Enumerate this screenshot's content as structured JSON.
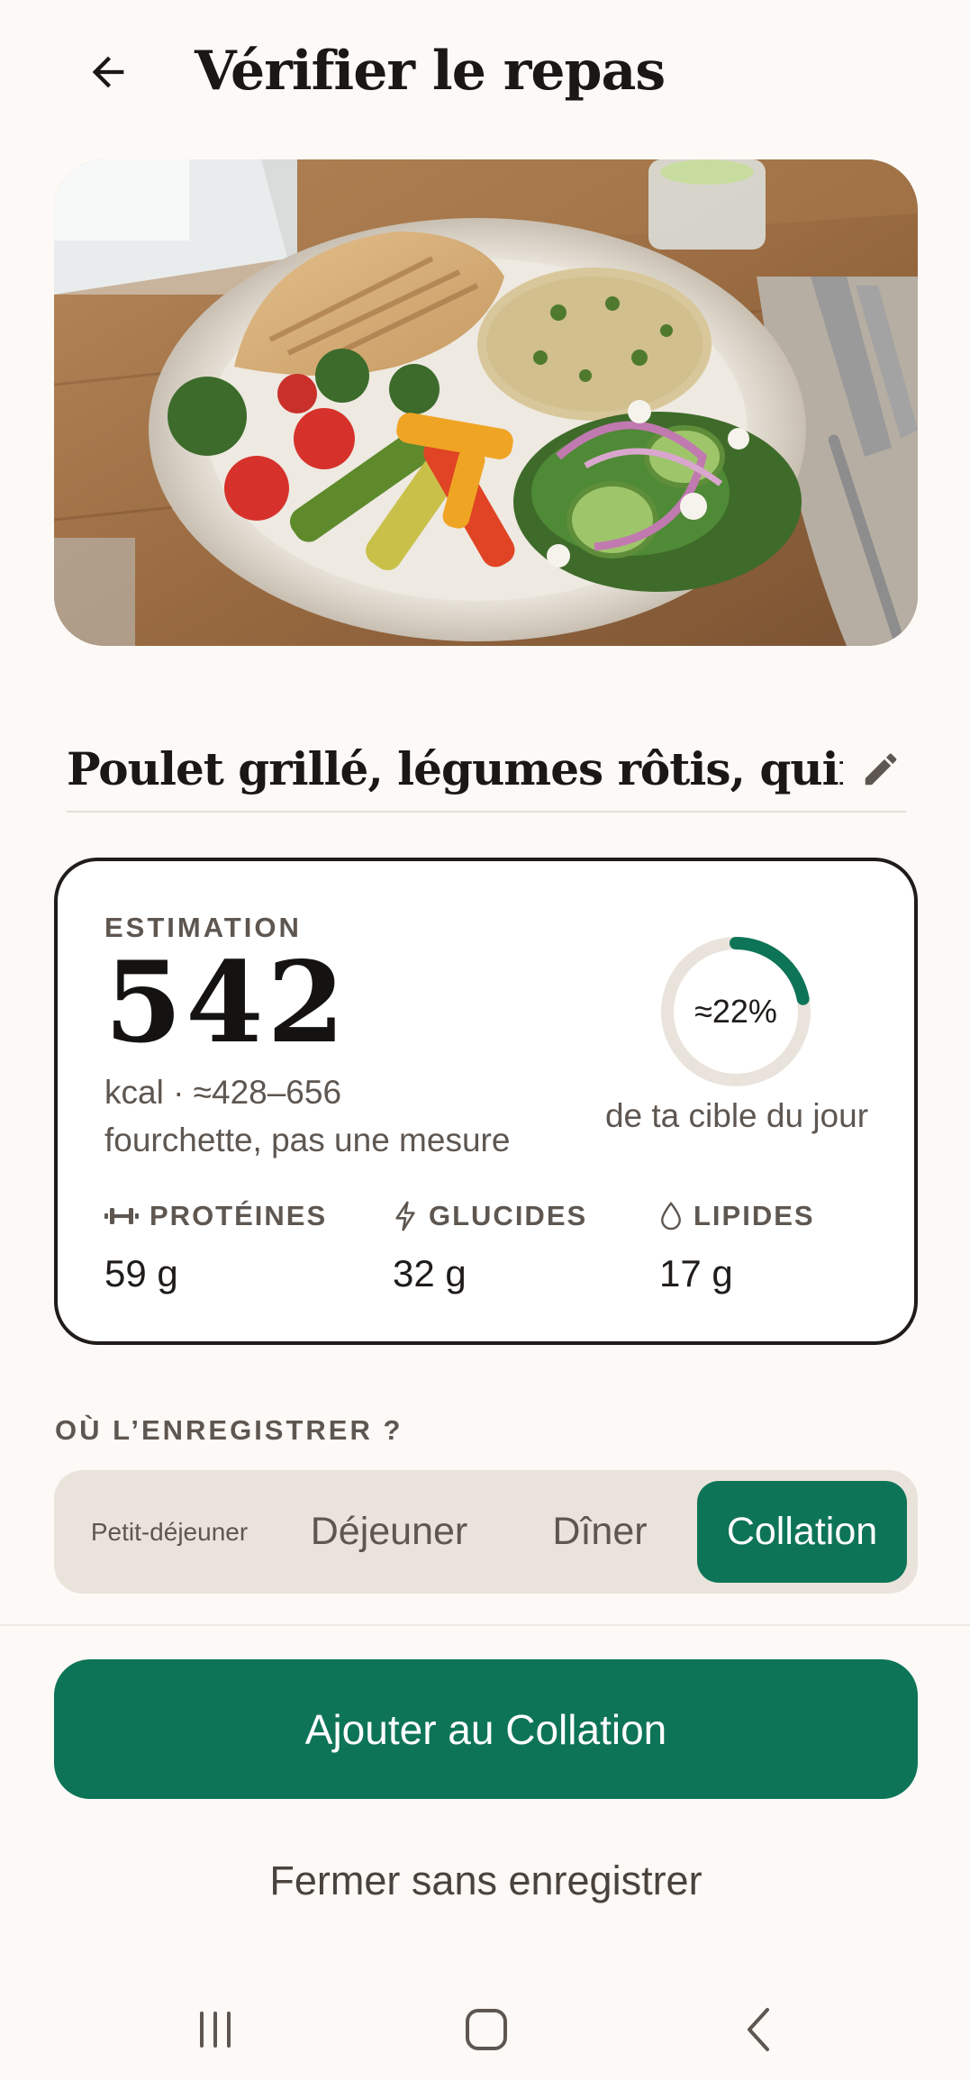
{
  "header": {
    "title": "Vérifier le repas",
    "back_icon": "arrow-left-icon"
  },
  "photo": {
    "alt": "grilled-chicken-meal-photo"
  },
  "meal": {
    "name": "Poulet grillé, légumes rôtis, quinoa",
    "edit_icon": "pencil-icon"
  },
  "estimate": {
    "label": "ESTIMATION",
    "kcal": "542",
    "range": "kcal · ≈428–656",
    "note": "fourchette, pas une mesure",
    "target_pct_label": "≈22%",
    "target_fraction": 0.22,
    "target_caption": "de ta cible du jour"
  },
  "macros": [
    {
      "icon": "dumbbell-icon",
      "label": "PROTÉINES",
      "value": "59 g"
    },
    {
      "icon": "lightning-icon",
      "label": "GLUCIDES",
      "value": "32 g"
    },
    {
      "icon": "droplet-icon",
      "label": "LIPIDES",
      "value": "17 g"
    }
  ],
  "save_section": {
    "label": "OÙ L’ENREGISTRER ?",
    "options": [
      "Petit-déjeuner",
      "Déjeuner",
      "Dîner",
      "Collation"
    ],
    "selected": "Collation"
  },
  "actions": {
    "primary": "Ajouter au Collation",
    "secondary": "Fermer sans enregistrer"
  },
  "colors": {
    "accent": "#0e7458",
    "background": "#fcf9f6",
    "ring_track": "#e9e3dc",
    "muted_text": "#5e5650"
  },
  "navbar": {
    "recent_icon": "recent-apps-icon",
    "home_icon": "home-icon",
    "back_icon": "nav-back-icon"
  }
}
